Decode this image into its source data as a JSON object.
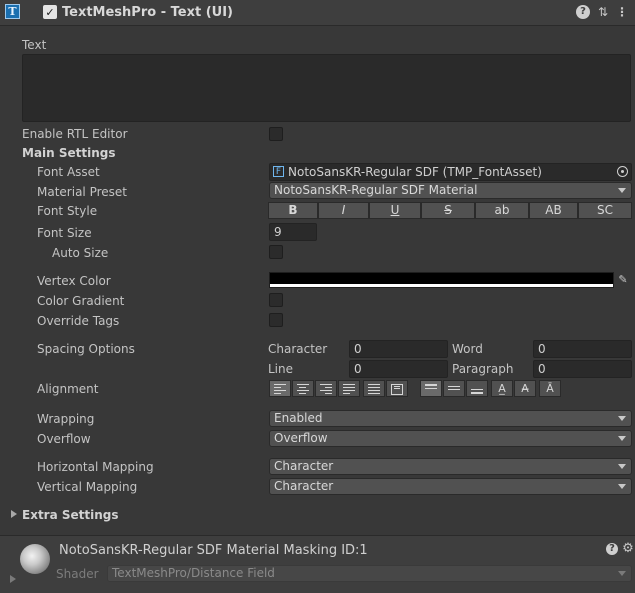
{
  "header": {
    "component_title": "TextMeshPro - Text (UI)",
    "enabled": true,
    "tmp_icon_glyph": "T",
    "icons": [
      "help-icon",
      "preset-icon",
      "more-icon"
    ]
  },
  "text_section": {
    "label": "Text",
    "value": ""
  },
  "enable_rtl": {
    "label": "Enable RTL Editor",
    "checked": false
  },
  "main_settings": {
    "title": "Main Settings",
    "font_asset": {
      "label": "Font Asset",
      "value": "NotoSansKR-Regular SDF (TMP_FontAsset)",
      "icon_glyph": "F"
    },
    "material_preset": {
      "label": "Material Preset",
      "value": "NotoSansKR-Regular SDF Material"
    },
    "font_style": {
      "label": "Font Style",
      "buttons": [
        "B",
        "I",
        "U",
        "S",
        "ab",
        "AB",
        "SC"
      ]
    },
    "font_size": {
      "label": "Font Size",
      "value": "9"
    },
    "auto_size": {
      "label": "Auto Size",
      "checked": false
    },
    "vertex_color": {
      "label": "Vertex Color",
      "color": "#000000"
    },
    "color_gradient": {
      "label": "Color Gradient",
      "checked": false
    },
    "override_tags": {
      "label": "Override Tags",
      "checked": false
    },
    "spacing": {
      "label": "Spacing Options",
      "character_label": "Character",
      "character_value": "0",
      "word_label": "Word",
      "word_value": "0",
      "line_label": "Line",
      "line_value": "0",
      "paragraph_label": "Paragraph",
      "paragraph_value": "0"
    },
    "alignment": {
      "label": "Alignment",
      "horizontal": [
        "align-left",
        "align-center",
        "align-right",
        "align-justified",
        "align-flush",
        "align-geometry-center"
      ],
      "vertical": [
        "align-top",
        "align-middle",
        "align-bottom",
        "align-baseline",
        "align-midline",
        "align-capline"
      ],
      "selected_horizontal": "align-left",
      "selected_vertical": "align-top"
    },
    "wrapping": {
      "label": "Wrapping",
      "value": "Enabled"
    },
    "overflow": {
      "label": "Overflow",
      "value": "Overflow"
    },
    "horizontal_mapping": {
      "label": "Horizontal Mapping",
      "value": "Character"
    },
    "vertical_mapping": {
      "label": "Vertical Mapping",
      "value": "Character"
    }
  },
  "extra_settings": {
    "title": "Extra Settings"
  },
  "material": {
    "title": "NotoSansKR-Regular SDF Material Masking ID:1",
    "shader_label": "Shader",
    "shader_value": "TextMeshPro/Distance Field"
  },
  "colors": {
    "panel_bg": "#383838",
    "field_bg": "#2a2a2a",
    "button_bg": "#515151",
    "accent_icon": "#1a6fb0"
  }
}
